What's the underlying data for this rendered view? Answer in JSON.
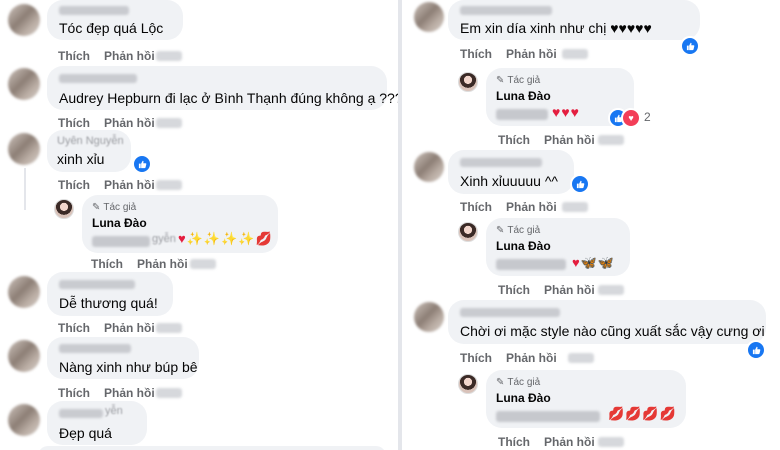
{
  "actions": {
    "like": "Thích",
    "reply": "Phản hồi"
  },
  "author_badge": "Tác giả",
  "left_comments": [
    {
      "text": "Tóc đẹp quá Lộc"
    },
    {
      "text": "Audrey Hepburn đi lạc ở Bình Thạnh đúng không ạ ???"
    },
    {
      "name_partial": "Uyên Nguyễn",
      "text": "xinh xỉu",
      "reply": {
        "author": "Luna Đào",
        "partial": "gyễn",
        "emoji": "♥✨✨✨✨💋"
      }
    },
    {
      "text": "Dễ thương quá!"
    },
    {
      "text": "Nàng xinh như búp bê"
    },
    {
      "name_partial": "yễn",
      "text": "Đẹp quá"
    }
  ],
  "right_comments": [
    {
      "text": "Em xin día xinh như chị ♥♥♥♥♥",
      "reply": {
        "author": "Luna Đào",
        "emoji": "♥♥♥",
        "reaction_count": "2"
      }
    },
    {
      "text": "Xinh xỉuuuuu ^^",
      "reply": {
        "author": "Luna Đào",
        "emoji": "♥🦋🦋"
      }
    },
    {
      "text": "Chời ơi mặc style nào cũng xuất sắc vậy cưng ơi",
      "reply": {
        "author": "Luna Đào",
        "emoji": "💋💋💋💋"
      }
    }
  ],
  "colors": {
    "like_blue": "#1877f2",
    "heart_red": "#f33e58",
    "bubble": "#f0f2f5",
    "action_gray": "#65676b"
  }
}
